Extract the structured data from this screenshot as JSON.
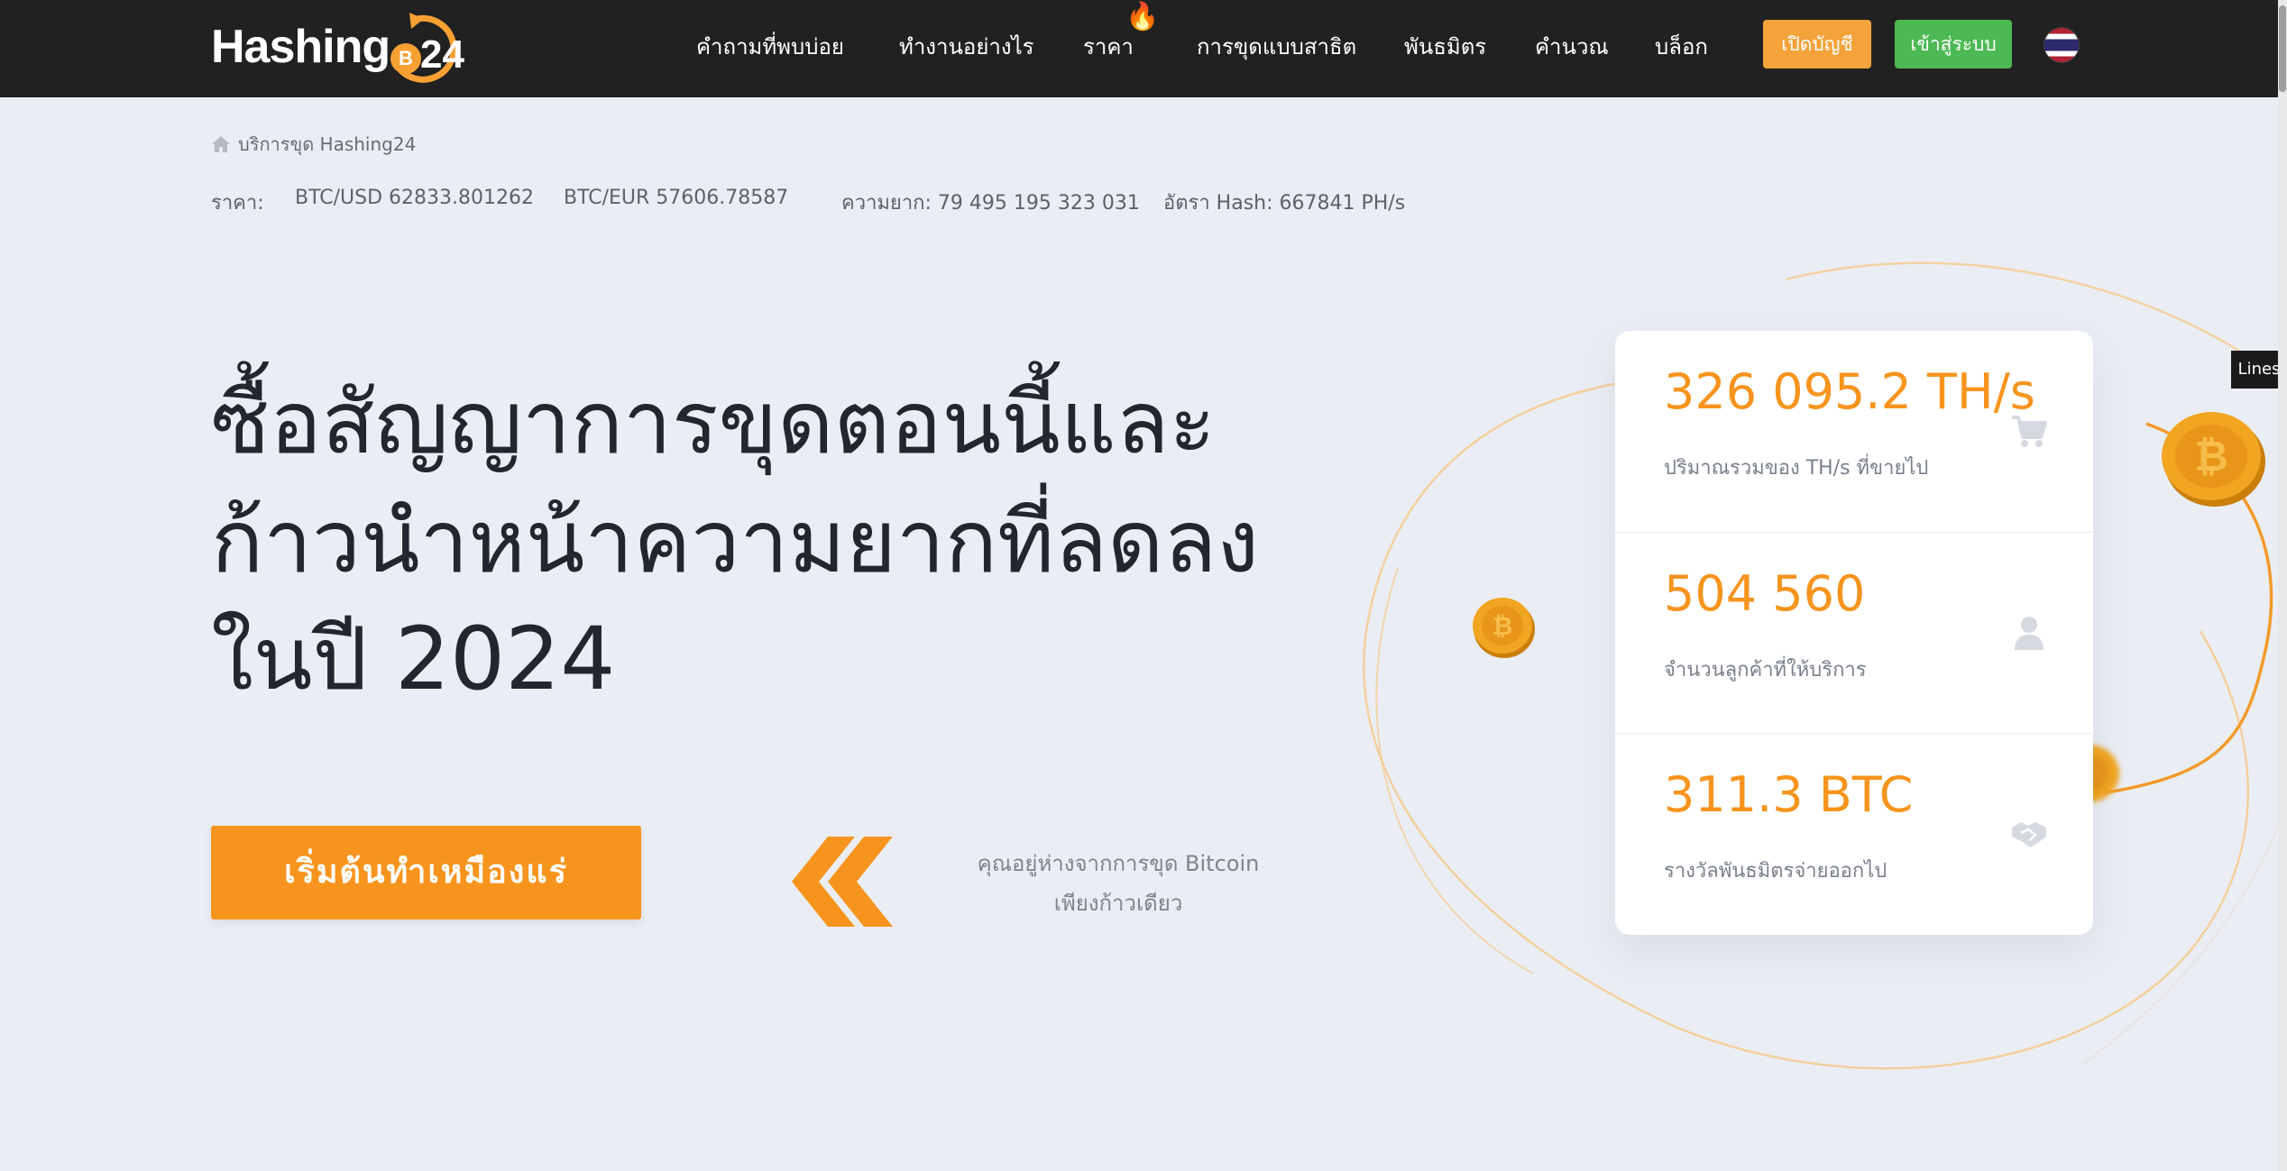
{
  "header": {
    "logo_text": "Hashing",
    "logo_number": "24",
    "logo_coin_symbol": "B",
    "nav": [
      {
        "label": "คำถามที่พบบ่อย"
      },
      {
        "label": "ทำงานอย่างไร"
      },
      {
        "label": "ราคา"
      },
      {
        "label": "การขุดแบบสาธิต"
      },
      {
        "label": "พันธมิตร"
      },
      {
        "label": "คำนวณ"
      },
      {
        "label": "บล็อก"
      }
    ],
    "hot_icon": "🔥",
    "open_account_label": "เปิดบัญชี",
    "login_label": "เข้าสู่ระบบ",
    "language_flag": "thailand-flag-icon"
  },
  "breadcrumb": {
    "label": "บริการขุด Hashing24"
  },
  "ticker": {
    "price_label": "ราคา:",
    "btc_usd": "BTC/USD 62833.801262",
    "btc_eur": "BTC/EUR 57606.78587",
    "difficulty": "ความยาก: 79 495 195 323 031",
    "hashrate": "อัตรา Hash: 667841 PH/s"
  },
  "hero": {
    "headline_lines": [
      "ซื้อสัญญาการขุดตอนนี้และ",
      "ก้าวนำหน้าความยากที่ลดลง",
      "ในปี 2024"
    ],
    "cta_label": "เริ่มต้นทำเหมืองแร่",
    "tagline_lines": [
      "คุณอยู่ห่างจากการขุด Bitcoin",
      "เพียงก้าวเดียว"
    ]
  },
  "stats": [
    {
      "value": "326 095.2 TH/s",
      "label": "ปริมาณรวมของ TH/s ที่ขายไป",
      "icon": "cart-icon"
    },
    {
      "value": "504 560",
      "label": "จำนวนลูกค้าที่ให้บริการ",
      "icon": "user-icon"
    },
    {
      "value": "311.3 BTC",
      "label": "รางวัลพันธมิตรจ่ายออกไป",
      "icon": "handshake-icon"
    }
  ],
  "side_tab": {
    "label": "Lines"
  },
  "colors": {
    "accent": "#f7941d",
    "header_bg": "#212121",
    "page_bg": "#eaeef4",
    "login_green": "#4db954",
    "open_orange": "#f3a33a"
  }
}
